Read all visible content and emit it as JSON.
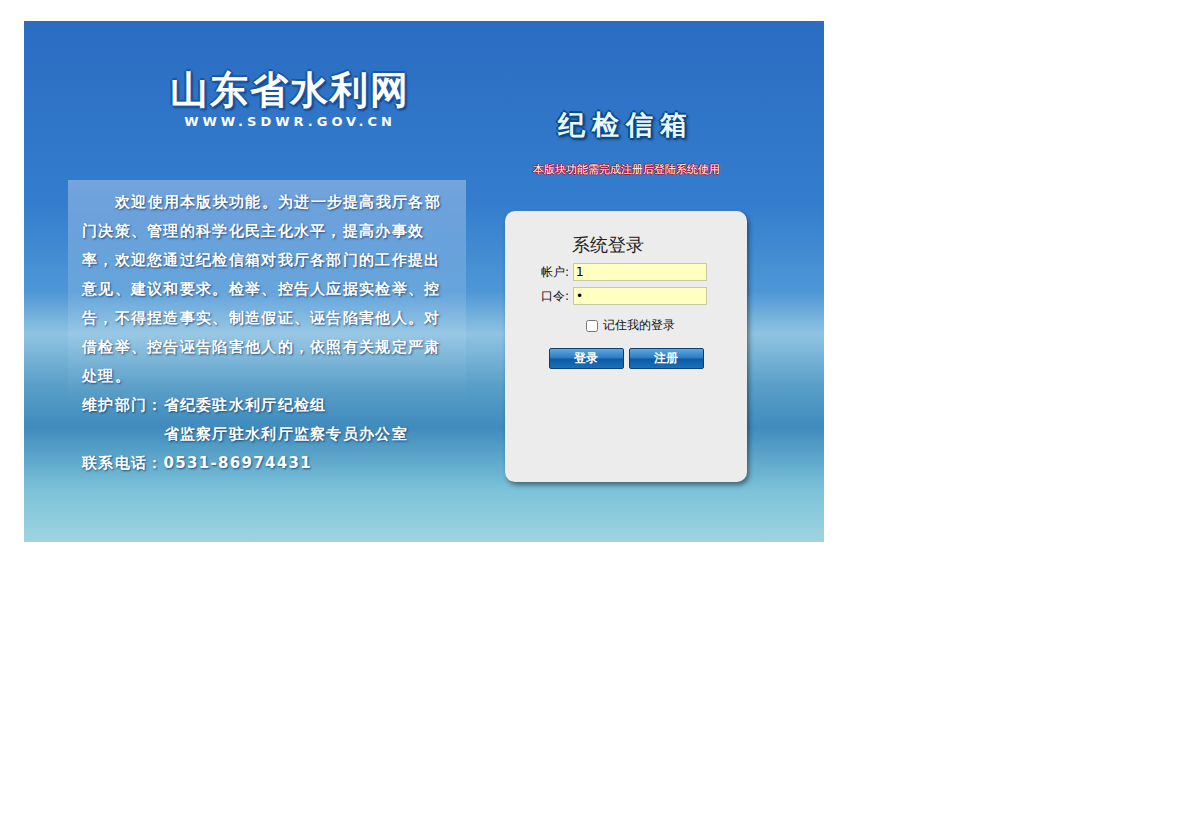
{
  "site": {
    "title": "山东省水利网",
    "url": "WWW.SDWR.GOV.CN"
  },
  "mailbox": {
    "title": "纪检信箱",
    "notice": "本版块功能需完成注册后登陆系统使用"
  },
  "intro": {
    "text": "欢迎使用本版块功能。为进一步提高我厅各部门决策、管理的科学化民主化水平，提高办事效率，欢迎您通过纪检信箱对我厅各部门的工作提出意见、建议和要求。检举、控告人应据实检举、控告，不得捏造事实、制造假证、诬告陷害他人。对借检举、控告诬告陷害他人的，依照有关规定严肃处理。",
    "maintainer_label": "维护部门：",
    "maintainers": [
      "省纪委驻水利厅纪检组",
      "省监察厅驻水利厅监察专员办公室"
    ],
    "phone_label": "联系电话：",
    "phone": "0531-86974431"
  },
  "login": {
    "title": "系统登录",
    "fields": [
      {
        "label": "帐户:",
        "value": "1"
      },
      {
        "label": "口令:",
        "value": "•"
      }
    ],
    "remember": {
      "label": "记住我的登录",
      "checked": false
    },
    "buttons": [
      "登录",
      "注册"
    ]
  }
}
